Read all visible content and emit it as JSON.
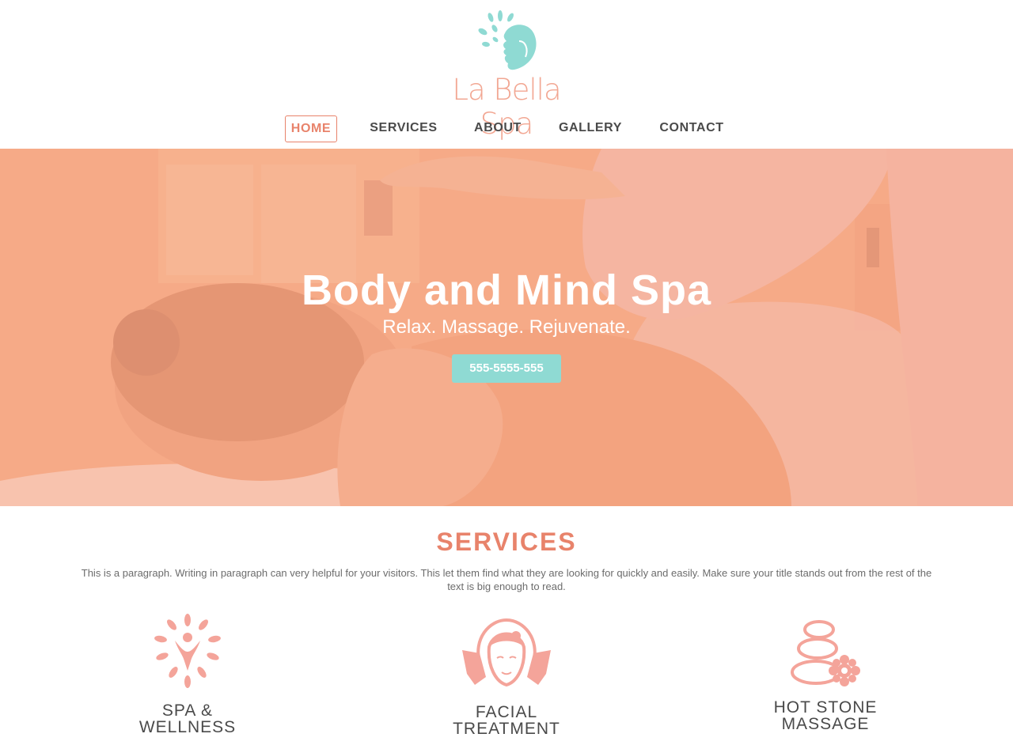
{
  "brand": {
    "name": "La Bella Spa"
  },
  "nav": {
    "items": [
      {
        "label": "HOME"
      },
      {
        "label": "SERVICES"
      },
      {
        "label": "ABOUT"
      },
      {
        "label": "GALLERY"
      },
      {
        "label": "CONTACT"
      }
    ],
    "active_index": 0
  },
  "hero": {
    "title": "Body and Mind Spa",
    "subtitle": "Relax. Massage. Rejuvenate.",
    "phone_button": "555-5555-555"
  },
  "services": {
    "title": "SERVICES",
    "paragraph": "This is a paragraph. Writing in paragraph can very helpful for your visitors. This let them find what they are looking for quickly and easily. Make sure your title stands out from the rest of the text is big enough to read.",
    "items": [
      {
        "line1": "SPA &",
        "line2": "WELLNESS",
        "icon": "wellness-figure-icon"
      },
      {
        "line1": "FACIAL",
        "line2": "TREATMENT",
        "icon": "facial-icon"
      },
      {
        "line1": "HOT STONE",
        "line2": "MASSAGE",
        "icon": "hot-stones-icon"
      }
    ]
  },
  "colors": {
    "accent": "#e8836b",
    "logo_mark": "#8fdad3",
    "button": "#8fdad3",
    "hero_overlay": "#f4a27f",
    "icon": "#f4a49a"
  }
}
